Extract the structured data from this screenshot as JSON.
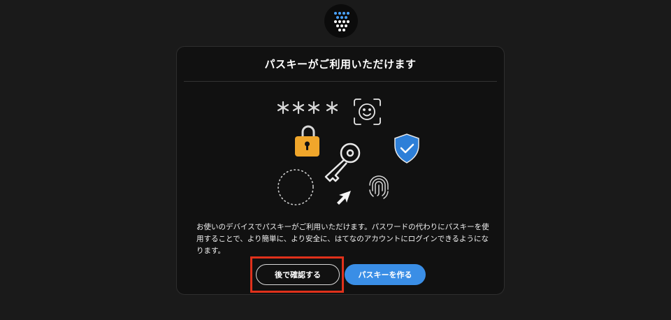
{
  "logo": {
    "name": "hatena-logo-icon"
  },
  "dialog": {
    "title": "パスキーがご利用いただけます",
    "description": "お使いのデバイスでパスキーがご利用いただけます。パスワードの代わりにパスキーを使用することで、より簡単に、より安全に、はてなのアカウントにログインできるようになります。",
    "password_mask": "****",
    "buttons": {
      "later": "後で確認する",
      "create": "パスキーを作る"
    }
  },
  "colors": {
    "background": "#1a1a1a",
    "card": "#111111",
    "accent_blue": "#3a8ee6",
    "lock_orange": "#f0a62b",
    "shield_blue": "#2d7fd8",
    "highlight_red": "#e0311b"
  },
  "icons": [
    "password-mask-icon",
    "face-id-icon",
    "lock-icon",
    "key-icon",
    "shield-check-icon",
    "dotted-circle-icon",
    "cursor-arrow-icon",
    "fingerprint-icon"
  ]
}
